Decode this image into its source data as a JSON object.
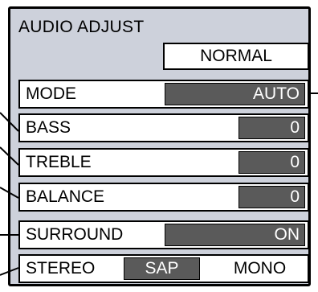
{
  "menu": {
    "title": "AUDIO ADJUST",
    "preset": "NORMAL",
    "rows": [
      {
        "label": "MODE",
        "value": "AUTO"
      },
      {
        "label": "BASS",
        "value": "0"
      },
      {
        "label": "TREBLE",
        "value": "0"
      },
      {
        "label": "BALANCE",
        "value": "0"
      },
      {
        "label": "SURROUND",
        "value": "ON"
      }
    ],
    "stereo_row": {
      "options": [
        "STEREO",
        "SAP",
        "MONO"
      ],
      "selected": "SAP"
    }
  },
  "colors": {
    "panel_bg": "#cdd1db",
    "value_bg": "#5a5a5a",
    "border": "#000000"
  }
}
